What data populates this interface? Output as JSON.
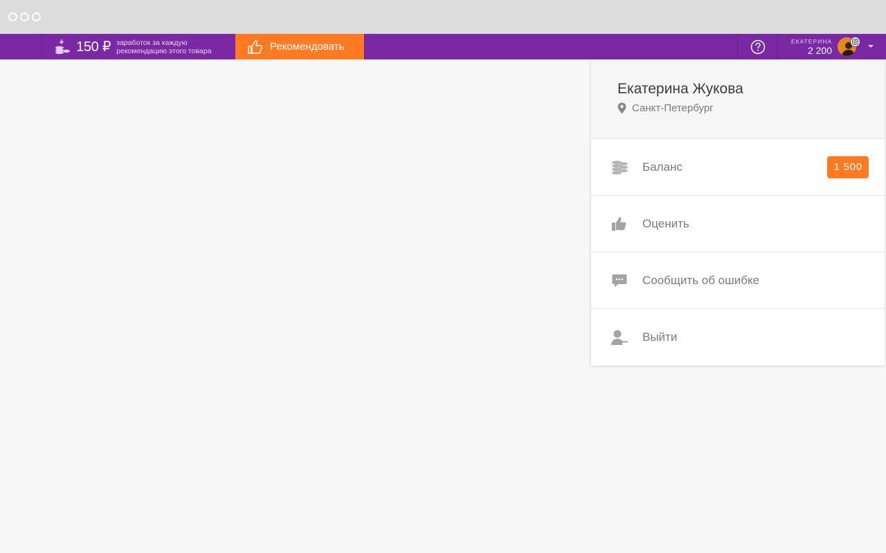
{
  "window": {
    "controls": [
      "close",
      "minimize",
      "maximize"
    ]
  },
  "topbar": {
    "bg_color": "#7b28a4",
    "earn_icon": "coins-download-icon",
    "earn_amount": "150 ₽",
    "earn_desc_line1": "заработок за каждую",
    "earn_desc_line2": "рекомендацию этого товара",
    "recommend_icon": "thumbs-up-icon",
    "recommend_label": "Рекомендовать",
    "recommend_color": "#ff7a21",
    "help_icon": "question-circle-icon",
    "user_name": "ЕКАТЕРИНА",
    "user_balance": "2 200",
    "avatar_icon": "user-avatar"
  },
  "panel": {
    "name": "Екатерина Жукова",
    "city": "Санкт-Петербург",
    "city_icon": "location-pin-icon",
    "items": [
      {
        "label": "Баланс",
        "icon": "coins-stack-icon",
        "badge": "1 500"
      },
      {
        "label": "Оценить",
        "icon": "thumbs-up-icon"
      },
      {
        "label": "Сообщить об ошибке",
        "icon": "chat-bubble-icon"
      },
      {
        "label": "Выйти",
        "icon": "user-logout-icon"
      }
    ]
  }
}
